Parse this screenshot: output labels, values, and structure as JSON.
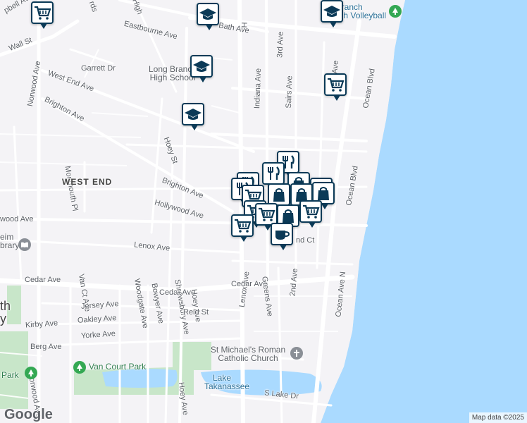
{
  "map": {
    "area_label": "WEST END",
    "streets": {
      "wall_st": "Wall St",
      "norwood_ave": "Norwood Ave",
      "norwood_ave_s": "Norwood Ave",
      "west_end_ave": "West End Ave",
      "garrett_dr": "Garrett Dr",
      "brighton_ave_w": "Brighton Ave",
      "brighton_ave": "Brighton Ave",
      "eastbourne_ave": "Eastbourne Ave",
      "bath_ave": "Bath Ave",
      "indiana_ave": "Indiana Ave",
      "third_ave": "3rd Ave",
      "sairs_ave": "Sairs Ave",
      "second_ave_n": "2nd Ave",
      "ocean_blvd": "Ocean Blvd",
      "ocean_blvd_s": "Ocean Blvd",
      "hoey_st": "Hoey St",
      "monmouth_pl": "Monmouth Pl",
      "hollywood_ave": "Hollywood Ave",
      "lenox_ave": "Lenox Ave",
      "lenox_ave_v": "Lenox Ave",
      "wood_ave": "wood Ave",
      "cedar_ave_w": "Cedar Ave",
      "cedar_ave_m": "Cedar Ave",
      "cedar_ave_e": "Cedar Ave",
      "van_ct_ave": "Van Ct Ave",
      "jersey_ave": "Jersey Ave",
      "oakley_ave": "Oakley Ave",
      "kirby_ave": "Kirby Ave",
      "yorke_ave": "Yorke Ave",
      "berg_ave": "Berg Ave",
      "woodgate_ave": "Woodgate Ave",
      "bowyer_ave": "Bowyer Ave",
      "shrewsbury_ave": "Shrewsbury Ave",
      "hoey_ave": "Hoey Ave",
      "hoey_ave_s": "Hoey Ave",
      "reid_st": "Reid St",
      "greens_ave": "Greens Ave",
      "second_ave_s": "2nd Ave",
      "ocean_ave_n": "Ocean Ave N",
      "lake_dr": "S Lake Dr",
      "nd_ct": "nd Ct",
      "rds": "rds",
      "bell_ave": "pbell Ave",
      "h_partial": "H",
      "high_partial": "High"
    },
    "places": {
      "high_school_line1": "Long Branch",
      "high_school_line2": "High School",
      "beach_line1": "ng Branch",
      "beach_line2": "Beach Volleyball",
      "church_line1": "St Michael's Roman",
      "church_line2": "Catholic Church",
      "van_court_park": "Van Court Park",
      "park_partial": "Park",
      "lake_line1": "Lake",
      "lake_line2": "Takanassee",
      "library_line1": "eim",
      "library_line2": "brary",
      "city_line1": "th",
      "city_line2": "y"
    },
    "attribution": "Map data ©2025",
    "logo": "Google"
  },
  "colors": {
    "water": "#aadaff",
    "park": "#c8e6c9",
    "road_main": "#ffffff",
    "marker_border": "#0b3a57"
  },
  "markers": [
    {
      "type": "shopping-cart",
      "label": ""
    },
    {
      "type": "school",
      "label": ""
    },
    {
      "type": "school",
      "label": ""
    },
    {
      "type": "school",
      "label": ""
    },
    {
      "type": "shopping-cart",
      "label": ""
    },
    {
      "type": "shopping-cart",
      "label": ""
    },
    {
      "type": "restaurant",
      "label": ""
    },
    {
      "type": "shopping-bag",
      "label": ""
    },
    {
      "type": "coffee",
      "label": ""
    }
  ]
}
